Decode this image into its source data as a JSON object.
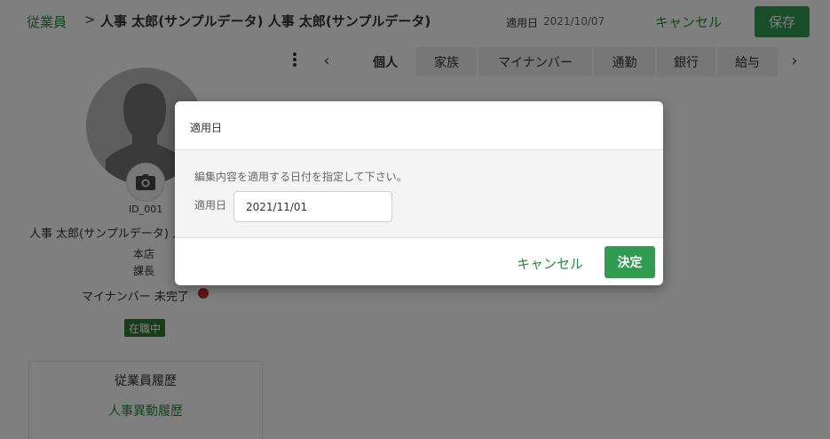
{
  "header": {
    "breadcrumb_root": "従業員",
    "breadcrumb_sep": ">",
    "title": "人事 太郎(サンプルデータ) 人事 太郎(サンプルデータ)",
    "effective_label": "適用日",
    "effective_date": "2021/10/07",
    "cancel_label": "キャンセル",
    "save_label": "保存"
  },
  "profile": {
    "camera_icon": "camera-icon",
    "id": "ID_001",
    "name": "人事 太郎(サンプルデータ) 人",
    "branch": "本店",
    "title": "課長",
    "mynumber_status": "マイナンバー 未完了",
    "status_dot_color": "#c62828",
    "employment_badge": "在職中"
  },
  "history": {
    "title": "従業員履歴",
    "link": "人事異動履歴"
  },
  "tabs": {
    "prev": "‹",
    "next": "›",
    "items": [
      {
        "label": "個人"
      },
      {
        "label": "家族"
      },
      {
        "label": "マイナンバー"
      },
      {
        "label": "通勤"
      },
      {
        "label": "銀行"
      },
      {
        "label": "給与"
      }
    ]
  },
  "modal": {
    "title": "適用日",
    "message": "編集内容を適用する日付を指定して下さい。",
    "date_label": "適用日",
    "date_value": "2021/11/01",
    "cancel_label": "キャンセル",
    "confirm_label": "決定"
  },
  "colors": {
    "accent": "#2e9b4f",
    "link": "#2b8a3e"
  }
}
